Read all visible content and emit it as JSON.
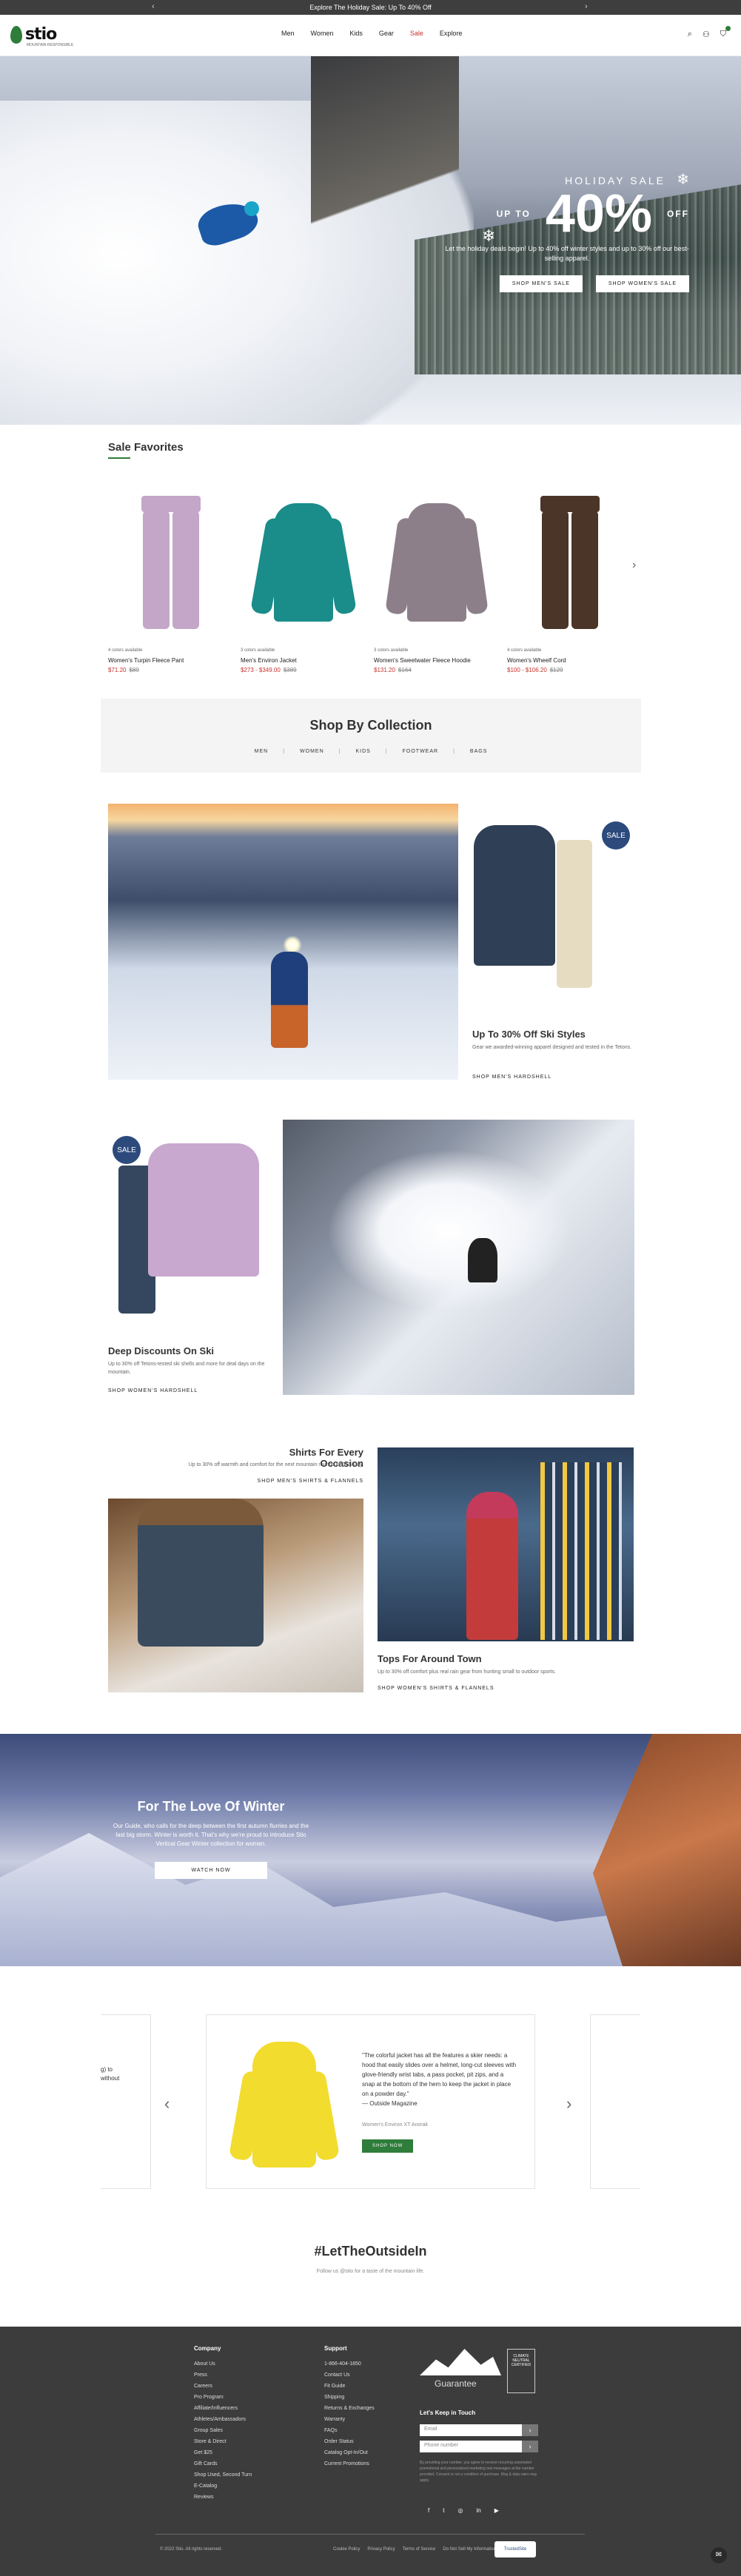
{
  "promo": {
    "text": "Explore The Holiday Sale: Up To 40% Off",
    "prev": "‹",
    "next": "›"
  },
  "header": {
    "logo": "stio",
    "logo_tag": "MOUNTAIN-RESPONSIBLE",
    "nav": [
      "Men",
      "Women",
      "Kids",
      "Gear",
      "Sale",
      "Explore"
    ],
    "icons": [
      "search-icon",
      "account-icon",
      "cart-icon"
    ]
  },
  "hero": {
    "kicker": "HOLIDAY SALE",
    "up_to": "UP TO",
    "percent": "40%",
    "off": "OFF",
    "copy": "Let the holiday deals begin! Up to 40% off winter styles and up to 30% off our best-selling apparel.",
    "btn_men": "SHOP MEN'S SALE",
    "btn_women": "SHOP WOMEN'S SALE"
  },
  "favorites": {
    "title": "Sale Favorites",
    "products": [
      {
        "colors": "4 colors available",
        "name": "Women's Turpin Fleece Pant",
        "price": "$71.20",
        "was": "$89",
        "color": "#c4a6c8"
      },
      {
        "colors": "3 colors available",
        "name": "Men's Environ Jacket",
        "price": "$273 - $349.00",
        "was": "$389",
        "color": "#1a8c8a"
      },
      {
        "colors": "3 colors available",
        "name": "Women's Sweetwater Fleece Hoodie",
        "price": "$131.20",
        "was": "$164",
        "color": "#8c7f8a"
      },
      {
        "colors": "4 colors available",
        "name": "Women's Wheelf Cord",
        "price": "$100 - $106.20",
        "was": "$129",
        "color": "#4a3528"
      }
    ]
  },
  "collection": {
    "title": "Shop By Collection",
    "links": [
      "MEN",
      "WOMEN",
      "KIDS",
      "FOOTWEAR",
      "BAGS"
    ]
  },
  "feature_ski": {
    "badge": "SALE",
    "title": "Up To 30% Off Ski Styles",
    "copy": "Gear we awarded-winning apparel designed and tested in the Tetons.",
    "link": "SHOP MEN'S HARDSHELL"
  },
  "feature_discounts": {
    "badge": "SALE",
    "title": "Deep Discounts On Ski",
    "copy": "Up to 30% off Tetons-tested ski shells and more for deal days on the mountain.",
    "link": "SHOP WOMEN'S HARDSHELL"
  },
  "shirts": {
    "title": "Shirts For Every Occasion",
    "copy": "Up to 30% off warmth and comfort for the next mountain rounds in DTS Day.",
    "link": "SHOP MEN'S SHIRTS & FLANNELS"
  },
  "tops": {
    "title": "Tops For Around Town",
    "copy": "Up to 30% off comfort plus real rain gear from hunting small to outdoor sports.",
    "link": "SHOP WOMEN'S SHIRTS & FLANNELS"
  },
  "winter": {
    "title": "For The Love Of Winter",
    "copy": "Our Guide, who calls for the deep between the first autumn flurries and the last big storm. Winter is worth it. That's why we're proud to introduce Stio Vertical Gear Winter collection for women.",
    "btn": "WATCH NOW"
  },
  "testimonial": {
    "left_frag": "g) to\nwithout",
    "quote": "\"The colorful jacket has all the features a skier needs: a hood that easily slides over a helmet, long-cut sleeves with glove-friendly wrist tabs, a pass pocket, pit zips, and a snap at the bottom of the hem to keep the jacket in place on a powder day.\"",
    "source": "— Outside Magazine",
    "product": "Women's Environ XT Anorak",
    "btn": "SHOP NOW",
    "prev": "‹",
    "next": "›",
    "jacket_color": "#f2dc2e"
  },
  "hashtag": {
    "title": "#LetTheOutsideIn",
    "sub": "Follow us @stio for a taste of the mountain life."
  },
  "footer": {
    "company_title": "Company",
    "company": [
      "About Us",
      "Press",
      "Careers",
      "Pro Program",
      "Affiliate/Influencers",
      "Athletes/Ambassadors",
      "Group Sales",
      "Store & Direct",
      "Get $25",
      "Gift Cards",
      "Shop Used, Second Turn",
      "E-Catalog",
      "Reviews"
    ],
    "support_title": "Support",
    "support": [
      "1-866-404-1850",
      "Contact Us",
      "Fit Guide",
      "Shipping",
      "Returns & Exchanges",
      "Warranty",
      "FAQs",
      "Order Status",
      "Catalog Opt-In/Out",
      "Current Promotions"
    ],
    "guarantee": "Guarantee",
    "badge": "CLIMATE NEUTRAL CERTIFIED",
    "keep_in_touch": "Let's Keep in Touch",
    "email_placeholder": "Email",
    "phone_placeholder": "Phone number",
    "go": "›",
    "fine_print": "By providing your number, you agree to receive recurring automated promotional and personalized marketing text messages at the number provided. Consent is not a condition of purchase. Msg & data rates may apply.",
    "social": [
      "f",
      "t",
      "◎",
      "in",
      "▶"
    ],
    "copyright": "© 2022 Stio. All rights reserved.",
    "legal": [
      "Cookie Policy",
      "Privacy Policy",
      "Terms of Service",
      "Do Not Sell My Information"
    ],
    "trust": "TrustedSite",
    "chat": "✉"
  },
  "colors": {
    "accent": "#2f7d3a",
    "sale": "#c8332b",
    "dark": "#3c3c3c",
    "badge": "#2c4a7c"
  }
}
